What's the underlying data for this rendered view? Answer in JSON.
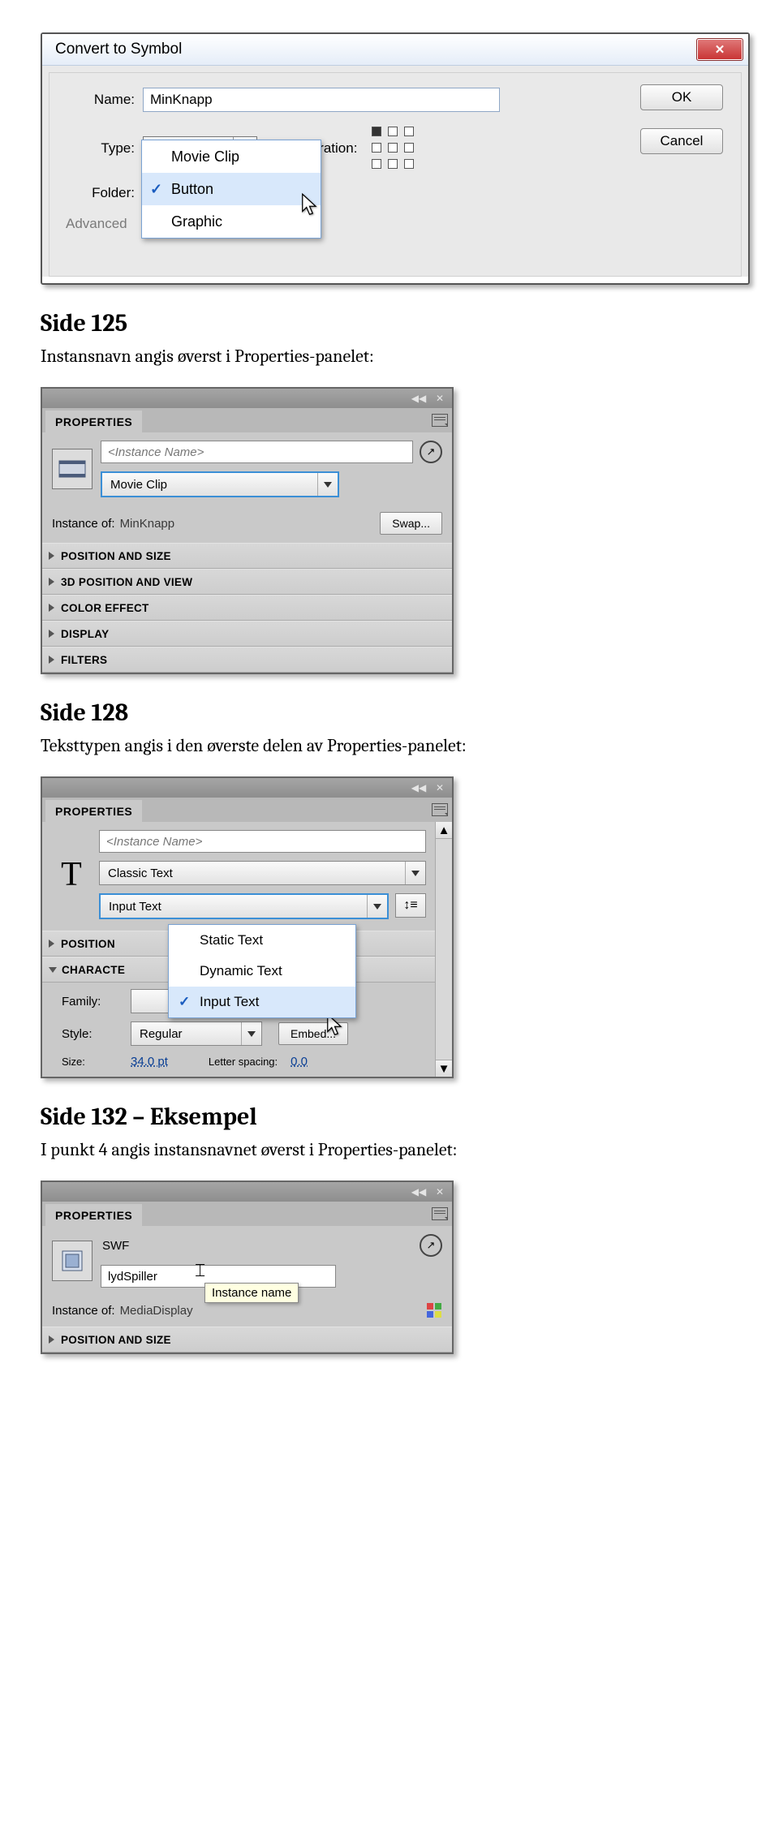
{
  "dialog": {
    "title": "Convert to Symbol",
    "name_label": "Name:",
    "name_value": "MinKnapp",
    "type_label": "Type:",
    "type_value": "Button",
    "type_options": [
      "Movie Clip",
      "Button",
      "Graphic"
    ],
    "reg_label": "Registration:",
    "folder_label": "Folder:",
    "advanced_label": "Advanced",
    "ok": "OK",
    "cancel": "Cancel"
  },
  "sec125": {
    "heading": "Side 125",
    "text": "Instansnavn angis øverst i Properties-panelet:"
  },
  "panel125": {
    "tab": "PROPERTIES",
    "instance_placeholder": "<Instance Name>",
    "type_value": "Movie Clip",
    "instance_of_label": "Instance of:",
    "instance_of_value": "MinKnapp",
    "swap": "Swap...",
    "accordions": [
      "POSITION AND SIZE",
      "3D POSITION AND VIEW",
      "COLOR EFFECT",
      "DISPLAY",
      "FILTERS"
    ]
  },
  "sec128": {
    "heading": "Side 128",
    "text": "Teksttypen angis i den øverste delen av Properties-panelet:"
  },
  "panel128": {
    "tab": "PROPERTIES",
    "instance_placeholder": "<Instance Name>",
    "engine_value": "Classic Text",
    "texttype_value": "Input Text",
    "texttype_options": [
      "Static Text",
      "Dynamic Text",
      "Input Text"
    ],
    "acc_position": "POSITION",
    "acc_character": "CHARACTE",
    "family_label": "Family:",
    "style_label": "Style:",
    "style_value": "Regular",
    "embed": "Embed...",
    "size_label": "Size:",
    "size_value": "34.0 pt",
    "spacing_label": "Letter spacing:",
    "spacing_value": "0.0"
  },
  "sec132": {
    "heading": "Side 132 – Eksempel",
    "text": "I punkt 4 angis instansnavnet øverst i Properties-panelet:"
  },
  "panel132": {
    "tab": "PROPERTIES",
    "comp_value": "SWF",
    "instance_value": "lydSpiller",
    "tooltip": "Instance name",
    "instance_of_label": "Instance of:",
    "instance_of_value": "MediaDisplay",
    "acc_position": "POSITION AND SIZE"
  }
}
